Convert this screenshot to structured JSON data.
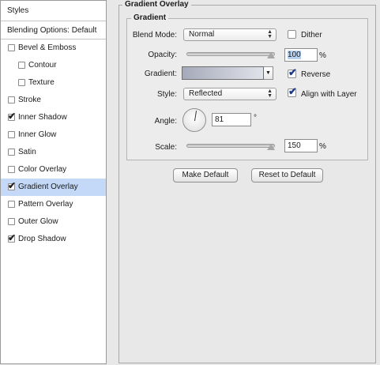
{
  "styles_list": {
    "header": "Styles",
    "blending_options": "Blending Options: Default",
    "items": [
      {
        "label": "Bevel & Emboss",
        "checked": false,
        "indent": false,
        "selected": false
      },
      {
        "label": "Contour",
        "checked": false,
        "indent": true,
        "selected": false
      },
      {
        "label": "Texture",
        "checked": false,
        "indent": true,
        "selected": false
      },
      {
        "label": "Stroke",
        "checked": false,
        "indent": false,
        "selected": false
      },
      {
        "label": "Inner Shadow",
        "checked": true,
        "indent": false,
        "selected": false
      },
      {
        "label": "Inner Glow",
        "checked": false,
        "indent": false,
        "selected": false
      },
      {
        "label": "Satin",
        "checked": false,
        "indent": false,
        "selected": false
      },
      {
        "label": "Color Overlay",
        "checked": false,
        "indent": false,
        "selected": false
      },
      {
        "label": "Gradient Overlay",
        "checked": true,
        "indent": false,
        "selected": true
      },
      {
        "label": "Pattern Overlay",
        "checked": false,
        "indent": false,
        "selected": false
      },
      {
        "label": "Outer Glow",
        "checked": false,
        "indent": false,
        "selected": false
      },
      {
        "label": "Drop Shadow",
        "checked": true,
        "indent": false,
        "selected": false
      }
    ]
  },
  "panel": {
    "title": "Gradient Overlay",
    "group_title": "Gradient",
    "blend_mode": {
      "label": "Blend Mode:",
      "value": "Normal"
    },
    "dither": {
      "label": "Dither",
      "checked": false
    },
    "opacity": {
      "label": "Opacity:",
      "value": "100",
      "unit": "%",
      "level": 1.0
    },
    "gradient": {
      "label": "Gradient:",
      "colors": [
        "#a5aaba",
        "#e1e3ea"
      ]
    },
    "reverse": {
      "label": "Reverse",
      "checked": true
    },
    "style": {
      "label": "Style:",
      "value": "Reflected"
    },
    "align_with_layer": {
      "label": "Align with Layer",
      "checked": true
    },
    "angle": {
      "label": "Angle:",
      "value": "81",
      "unit": "°",
      "degrees": 81
    },
    "scale": {
      "label": "Scale:",
      "value": "150",
      "unit": "%",
      "level": 1.0
    }
  },
  "buttons": {
    "make_default": "Make Default",
    "reset_to_default": "Reset to Default"
  },
  "colors": {
    "selected_row": "#c3d9f7",
    "panel_bg": "#e8e8e8",
    "check_tick": "#1b3c8a"
  }
}
